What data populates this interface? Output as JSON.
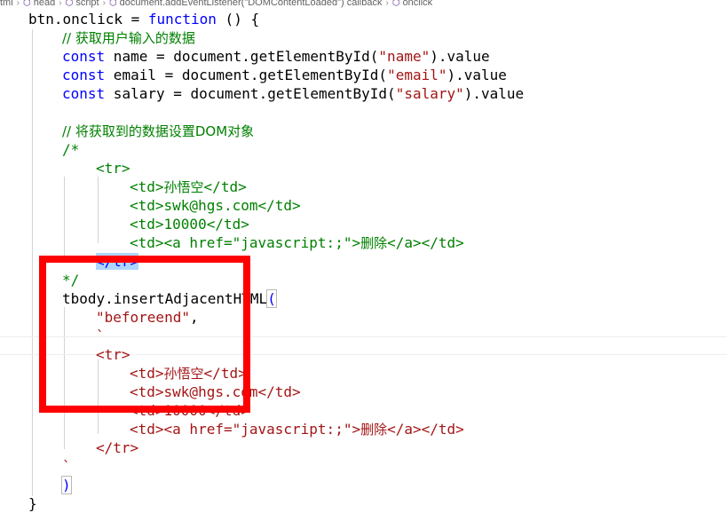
{
  "breadcrumb": {
    "items": [
      {
        "label": "tml",
        "icon": ""
      },
      {
        "label": "head",
        "icon": "cube-icon"
      },
      {
        "label": "script",
        "icon": "cube-icon"
      },
      {
        "label": "document.addEventListener(\"DOMContentLoaded\") callback",
        "icon": "cube-icon"
      },
      {
        "label": "onclick",
        "icon": "cube-icon"
      }
    ],
    "separator": "›"
  },
  "code": {
    "l1": {
      "a": "btn.onclick = ",
      "b": "function",
      "c": " () {"
    },
    "l2": {
      "a": "// 获取用户输入的数据"
    },
    "l3": {
      "a": "const",
      "b": " name = document.getElementById(",
      "c": "\"name\"",
      "d": ").value"
    },
    "l4": {
      "a": "const",
      "b": " email = document.getElementById(",
      "c": "\"email\"",
      "d": ").value"
    },
    "l5": {
      "a": "const",
      "b": " salary = document.getElementById(",
      "c": "\"salary\"",
      "d": ").value"
    },
    "l7": {
      "a": "// 将获取到的数据设置DOM对象"
    },
    "l8": {
      "a": "/*"
    },
    "l9": {
      "a": "<tr>"
    },
    "l10": {
      "a": "<td>",
      "b": "孙悟空",
      "c": "</td>"
    },
    "l11": {
      "a": "<td>swk@hgs.com</td>"
    },
    "l12": {
      "a": "<td>10000</td>"
    },
    "l13": {
      "a": "<td><a href=\"javascript:;\">",
      "b": "删除",
      "c": "</a></td>"
    },
    "l14": {
      "a": "</tr>"
    },
    "l15": {
      "a": "*/"
    },
    "l16": {
      "a": "tbody.insertAdjacentHTML",
      "b": "("
    },
    "l17": {
      "a": "\"beforeend\"",
      "b": ","
    },
    "l18": {
      "a": "`"
    },
    "l19": {
      "a": "<tr>"
    },
    "l20": {
      "a": "<td>",
      "b": "孙悟空",
      "c": "</td>"
    },
    "l21": {
      "a": "<td>swk@hgs.com</td>"
    },
    "l22": {
      "a": "<td>10000</td>"
    },
    "l23": {
      "a": "<td><a href=\"javascript:;\">",
      "b": "删除",
      "c": "</a></td>"
    },
    "l24": {
      "a": "</tr>"
    },
    "l25": {
      "a": "`"
    },
    "l26": {
      "a": ")"
    },
    "l27": {
      "a": "}"
    }
  },
  "colors": {
    "keyword": "#0000ff",
    "string": "#a31515",
    "comment": "#008000",
    "annotation_box": "#ff0000"
  }
}
